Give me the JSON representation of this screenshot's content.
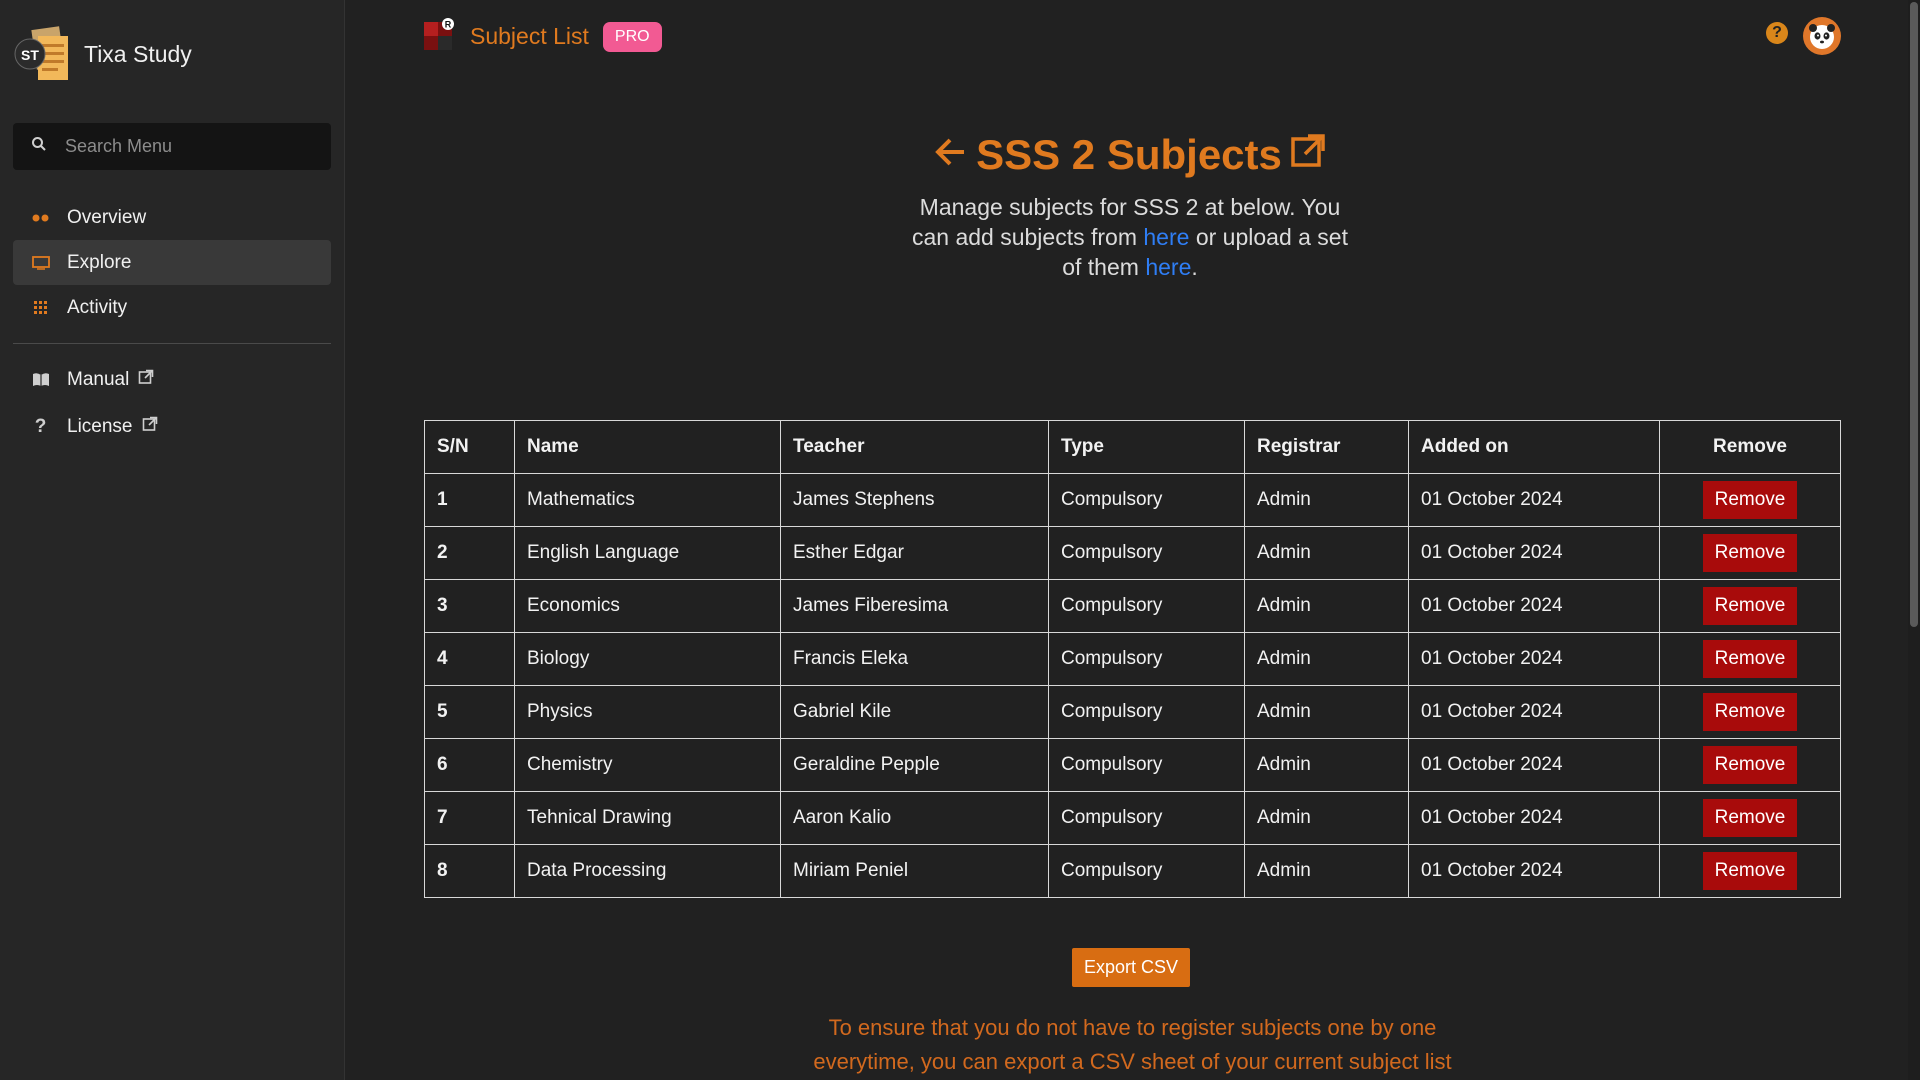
{
  "app": {
    "name": "Tixa Study",
    "logo_text": "ST"
  },
  "sidebar": {
    "search_placeholder": "Search Menu",
    "items": [
      {
        "label": "Overview",
        "icon": "dots-icon",
        "active": false
      },
      {
        "label": "Explore",
        "icon": "monitor-icon",
        "active": true
      },
      {
        "label": "Activity",
        "icon": "grid-icon",
        "active": false
      }
    ],
    "secondary_items": [
      {
        "label": "Manual",
        "icon": "book-icon"
      },
      {
        "label": "License",
        "icon": "question-icon"
      }
    ]
  },
  "topbar": {
    "title": "Subject List",
    "badge": "PRO",
    "help": "?"
  },
  "header": {
    "title": "SSS 2 Subjects",
    "desc_part1": "Manage subjects for SSS 2 at below. You can add subjects from ",
    "link1": "here",
    "desc_part2": " or upload a set of them ",
    "link2": "here",
    "desc_part3": "."
  },
  "table": {
    "columns": [
      "S/N",
      "Name",
      "Teacher",
      "Type",
      "Registrar",
      "Added on",
      "Remove"
    ],
    "remove_label": "Remove",
    "rows": [
      {
        "sn": "1",
        "name": "Mathematics",
        "teacher": "James Stephens",
        "type": "Compulsory",
        "registrar": "Admin",
        "added": "01 October 2024"
      },
      {
        "sn": "2",
        "name": "English Language",
        "teacher": "Esther Edgar",
        "type": "Compulsory",
        "registrar": "Admin",
        "added": "01 October 2024"
      },
      {
        "sn": "3",
        "name": "Economics",
        "teacher": "James Fiberesima",
        "type": "Compulsory",
        "registrar": "Admin",
        "added": "01 October 2024"
      },
      {
        "sn": "4",
        "name": "Biology",
        "teacher": "Francis Eleka",
        "type": "Compulsory",
        "registrar": "Admin",
        "added": "01 October 2024"
      },
      {
        "sn": "5",
        "name": "Physics",
        "teacher": "Gabriel Kile",
        "type": "Compulsory",
        "registrar": "Admin",
        "added": "01 October 2024"
      },
      {
        "sn": "6",
        "name": "Chemistry",
        "teacher": "Geraldine Pepple",
        "type": "Compulsory",
        "registrar": "Admin",
        "added": "01 October 2024"
      },
      {
        "sn": "7",
        "name": "Tehnical Drawing",
        "teacher": "Aaron Kalio",
        "type": "Compulsory",
        "registrar": "Admin",
        "added": "01 October 2024"
      },
      {
        "sn": "8",
        "name": "Data Processing",
        "teacher": "Miriam Peniel",
        "type": "Compulsory",
        "registrar": "Admin",
        "added": "01 October 2024"
      }
    ]
  },
  "export": {
    "button_label": "Export CSV",
    "note": "To ensure that you do not have to register subjects one by one everytime, you can export a CSV sheet of your current subject list"
  },
  "colors": {
    "accent": "#e07a1f",
    "badge": "#f25a93",
    "danger": "#a80b0b",
    "link": "#2f7ef5",
    "background": "#212121"
  }
}
